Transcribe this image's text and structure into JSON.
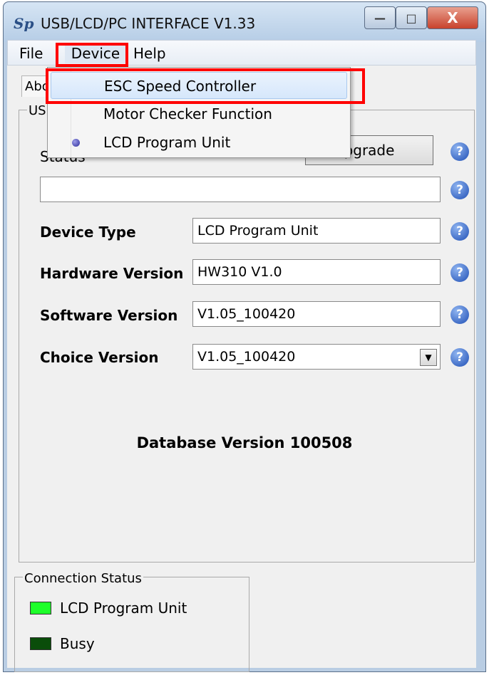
{
  "window": {
    "title": "USB/LCD/PC INTERFACE V1.33",
    "app_icon_text": "Sp",
    "minimize_glyph": "—",
    "maximize_glyph": "□",
    "close_glyph": "X"
  },
  "menubar": {
    "file": "File",
    "device": "Device",
    "help": "Help"
  },
  "tab": {
    "about": "Abou"
  },
  "group_usb": {
    "legend": "USB"
  },
  "upgrade_button": "pgrade",
  "status": {
    "label": "Status",
    "value": ""
  },
  "device_type": {
    "label": "Device Type",
    "value": "LCD Program Unit"
  },
  "hardware_version": {
    "label": "Hardware Version",
    "value": "HW310 V1.0"
  },
  "software_version": {
    "label": "Software Version",
    "value": "V1.05_100420"
  },
  "choice_version": {
    "label": "Choice Version",
    "value": "V1.05_100420",
    "arrow_glyph": "▼"
  },
  "help_glyph": "?",
  "database_version": "Database Version 100508",
  "connection_status": {
    "legend": "Connection Status",
    "indicators": [
      {
        "label": "LCD Program Unit",
        "color": "#1eff2a"
      },
      {
        "label": "Busy",
        "color": "#0a4d0a"
      }
    ]
  },
  "device_menu": {
    "items": [
      {
        "label": "ESC Speed Controller",
        "selected": false,
        "highlighted": true
      },
      {
        "label": "Motor Checker Function",
        "selected": false,
        "highlighted": false
      },
      {
        "label": "LCD Program Unit",
        "selected": true,
        "highlighted": false
      }
    ]
  },
  "annotation_color": "#ff0000"
}
